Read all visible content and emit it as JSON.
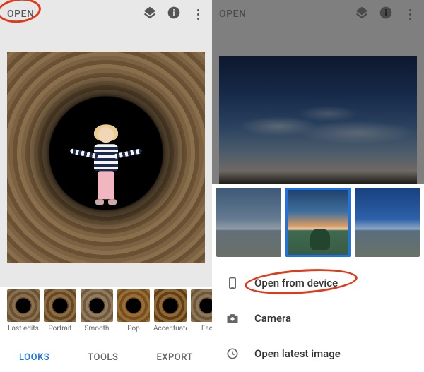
{
  "left": {
    "open_label": "OPEN",
    "filters": [
      "Last edits",
      "Portrait",
      "Smooth",
      "Pop",
      "Accentuate",
      "Fac"
    ],
    "tabs": {
      "looks": "LOOKS",
      "tools": "TOOLS",
      "export": "EXPORT"
    },
    "active_tab": "LOOKS"
  },
  "right": {
    "open_label": "OPEN",
    "menu": {
      "open_from_device": "Open from device",
      "camera": "Camera",
      "open_latest": "Open latest image"
    },
    "recent_selected_index": 1
  },
  "annotations": {
    "open_circled": true,
    "open_from_device_circled": true
  },
  "colors": {
    "accent": "#1a73e8",
    "annotation": "#e03a1a"
  }
}
